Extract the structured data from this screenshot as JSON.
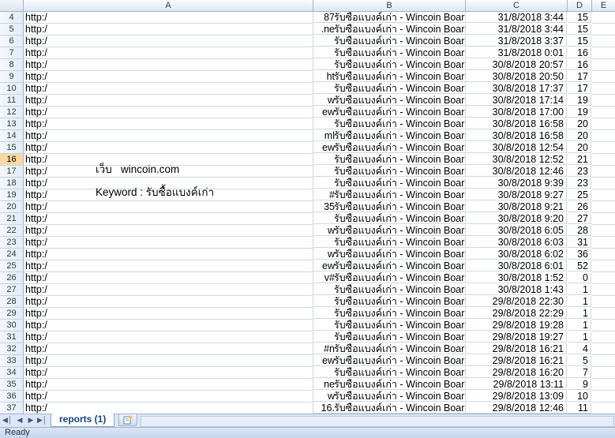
{
  "columns": [
    "A",
    "B",
    "C",
    "D",
    "E"
  ],
  "rows": [
    {
      "num": "4",
      "a": "http:/",
      "a_suffix": "87",
      "b": "รับซื้อแบงค์เก่า - Wincoin Board",
      "c": "31/8/2018 3:44",
      "d": "15"
    },
    {
      "num": "5",
      "a": "http:/",
      "a_suffix": ".ne",
      "b": "รับซื้อแบงค์เก่า - Wincoin Board",
      "c": "31/8/2018 3:44",
      "d": "15"
    },
    {
      "num": "6",
      "a": "http:/",
      "a_suffix": "",
      "b": "รับซื้อแบงค์เก่า - Wincoin Board",
      "c": "31/8/2018 3:37",
      "d": "15"
    },
    {
      "num": "7",
      "a": "http:/",
      "a_suffix": "",
      "b": "รับซื้อแบงค์เก่า - Wincoin Board",
      "c": "31/8/2018 0:01",
      "d": "16"
    },
    {
      "num": "8",
      "a": "http:/",
      "a_suffix": "",
      "b": "รับซื้อแบงค์เก่า - Wincoin Board",
      "c": "30/8/2018 20:57",
      "d": "16"
    },
    {
      "num": "9",
      "a": "http:/",
      "a_suffix": "ht",
      "b": "รับซื้อแบงค์เก่า - Wincoin Board",
      "c": "30/8/2018 20:50",
      "d": "17"
    },
    {
      "num": "10",
      "a": "http:/",
      "a_suffix": "",
      "b": "รับซื้อแบงค์เก่า - Wincoin Board",
      "c": "30/8/2018 17:37",
      "d": "17"
    },
    {
      "num": "11",
      "a": "http:/",
      "a_suffix": "w",
      "b": "รับซื้อแบงค์เก่า - Wincoin Board",
      "c": "30/8/2018 17:14",
      "d": "19"
    },
    {
      "num": "12",
      "a": "http:/",
      "a_suffix": "ew",
      "b": "รับซื้อแบงค์เก่า - Wincoin Board",
      "c": "30/8/2018 17:00",
      "d": "19"
    },
    {
      "num": "13",
      "a": "http:/",
      "a_suffix": "",
      "b": "รับซื้อแบงค์เก่า - Wincoin Board",
      "c": "30/8/2018 16:58",
      "d": "20"
    },
    {
      "num": "14",
      "a": "http:/",
      "a_suffix": "ml",
      "b": "รับซื้อแบงค์เก่า - Wincoin Board",
      "c": "30/8/2018 16:58",
      "d": "20"
    },
    {
      "num": "15",
      "a": "http:/",
      "a_suffix": "ew",
      "b": "รับซื้อแบงค์เก่า - Wincoin Board",
      "c": "30/8/2018 12:54",
      "d": "20"
    },
    {
      "num": "16",
      "a": "http:/",
      "a_suffix": "",
      "b": "รับซื้อแบงค์เก่า - Wincoin Board",
      "c": "30/8/2018 12:52",
      "d": "21",
      "selected": true
    },
    {
      "num": "17",
      "a": "http:/",
      "a_suffix": "",
      "b": "รับซื้อแบงค์เก่า - Wincoin Board",
      "c": "30/8/2018 12:46",
      "d": "23"
    },
    {
      "num": "18",
      "a": "http:/",
      "a_suffix": "",
      "b": "รับซื้อแบงค์เก่า - Wincoin Board",
      "c": "30/8/2018 9:39",
      "d": "23"
    },
    {
      "num": "19",
      "a": "http:/",
      "a_suffix": "#",
      "b": "รับซื้อแบงค์เก่า - Wincoin Board",
      "c": "30/8/2018 9:27",
      "d": "25"
    },
    {
      "num": "20",
      "a": "http:/",
      "a_suffix": "35",
      "b": "รับซื้อแบงค์เก่า - Wincoin Board",
      "c": "30/8/2018 9:21",
      "d": "26"
    },
    {
      "num": "21",
      "a": "http:/",
      "a_suffix": "",
      "b": "รับซื้อแบงค์เก่า - Wincoin Board",
      "c": "30/8/2018 9:20",
      "d": "27"
    },
    {
      "num": "22",
      "a": "http:/",
      "a_suffix": "w",
      "b": "รับซื้อแบงค์เก่า - Wincoin Board",
      "c": "30/8/2018 6:05",
      "d": "28"
    },
    {
      "num": "23",
      "a": "http:/",
      "a_suffix": "",
      "b": "รับซื้อแบงค์เก่า - Wincoin Board",
      "c": "30/8/2018 6:03",
      "d": "31"
    },
    {
      "num": "24",
      "a": "http:/",
      "a_suffix": "w",
      "b": "รับซื้อแบงค์เก่า - Wincoin Board",
      "c": "30/8/2018 6:02",
      "d": "36"
    },
    {
      "num": "25",
      "a": "http:/",
      "a_suffix": "ew",
      "b": "รับซื้อแบงค์เก่า - Wincoin Board",
      "c": "30/8/2018 6:01",
      "d": "52"
    },
    {
      "num": "26",
      "a": "http:/",
      "a_suffix": "v#",
      "b": "รับซื้อแบงค์เก่า - Wincoin Board",
      "c": "30/8/2018 1:52",
      "d": "0"
    },
    {
      "num": "27",
      "a": "http:/",
      "a_suffix": "",
      "b": "รับซื้อแบงค์เก่า - Wincoin Board",
      "c": "30/8/2018 1:43",
      "d": "1"
    },
    {
      "num": "28",
      "a": "http:/",
      "a_suffix": "",
      "b": "รับซื้อแบงค์เก่า - Wincoin Board",
      "c": "29/8/2018 22:30",
      "d": "1"
    },
    {
      "num": "29",
      "a": "http:/",
      "a_suffix": "",
      "b": "รับซื้อแบงค์เก่า - Wincoin Board",
      "c": "29/8/2018 22:29",
      "d": "1"
    },
    {
      "num": "30",
      "a": "http:/",
      "a_suffix": "",
      "b": "รับซื้อแบงค์เก่า - Wincoin Board",
      "c": "29/8/2018 19:28",
      "d": "1"
    },
    {
      "num": "31",
      "a": "http:/",
      "a_suffix": "",
      "b": "รับซื้อแบงค์เก่า - Wincoin Board",
      "c": "29/8/2018 19:27",
      "d": "1"
    },
    {
      "num": "32",
      "a": "http:/",
      "a_suffix": "#n",
      "b": "รับซื้อแบงค์เก่า - Wincoin Board",
      "c": "29/8/2018 16:21",
      "d": "4"
    },
    {
      "num": "33",
      "a": "http:/",
      "a_suffix": "ew",
      "b": "รับซื้อแบงค์เก่า - Wincoin Board",
      "c": "29/8/2018 16:21",
      "d": "5"
    },
    {
      "num": "34",
      "a": "http:/",
      "a_suffix": "",
      "b": "รับซื้อแบงค์เก่า - Wincoin Board",
      "c": "29/8/2018 16:20",
      "d": "7"
    },
    {
      "num": "35",
      "a": "http:/",
      "a_suffix": "ne",
      "b": "รับซื้อแบงค์เก่า - Wincoin Board",
      "c": "29/8/2018 13:11",
      "d": "9"
    },
    {
      "num": "36",
      "a": "http:/",
      "a_suffix": "w",
      "b": "รับซื้อแบงค์เก่า - Wincoin Board",
      "c": "29/8/2018 13:09",
      "d": "10"
    },
    {
      "num": "37",
      "a": "http:/",
      "a_suffix": "16.",
      "b": "รับซื้อแบงค์เก่า - Wincoin Board",
      "c": "29/8/2018 12:46",
      "d": "11"
    }
  ],
  "overlay": {
    "web_label": "เว็บ",
    "web_value": "wincoin.com",
    "keyword_label": "Keyword :",
    "keyword_value": "รับซื้อแบงค์เก่า"
  },
  "sheet": {
    "tab_label": "reports (1)",
    "status": "Ready"
  },
  "icons": {
    "nav_first": "first-sheet-icon",
    "nav_prev": "prev-sheet-icon",
    "nav_next": "next-sheet-icon",
    "nav_last": "last-sheet-icon",
    "new_sheet": "insert-sheet-icon"
  },
  "colors": {
    "selected_row_header": "#f9d99f",
    "header_border": "#9eb6ce",
    "sheet_tab_text": "#15428b"
  }
}
